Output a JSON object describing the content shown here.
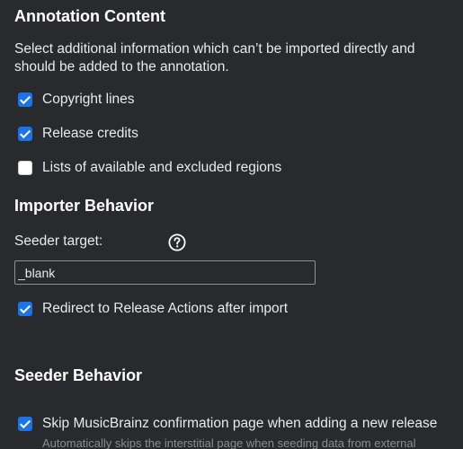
{
  "annotation": {
    "title": "Annotation Content",
    "description": "Select additional information which can’t be imported directly and should be added to the annotation.",
    "options": [
      {
        "label": "Copyright lines",
        "checked": true
      },
      {
        "label": "Release credits",
        "checked": true
      },
      {
        "label": "Lists of available and excluded regions",
        "checked": false
      }
    ]
  },
  "importer": {
    "title": "Importer Behavior",
    "seeder_target_label": "Seeder target:",
    "seeder_target_value": "_blank",
    "help_icon": "question-circle-icon",
    "redirect_label": "Redirect to Release Actions after import",
    "redirect_checked": true
  },
  "seeder": {
    "title": "Seeder Behavior",
    "skip_label": "Skip MusicBrainz confirmation page when adding a new release",
    "skip_checked": true,
    "skip_description": "Automatically skips the interstitial page when seeding data from external"
  },
  "colors": {
    "background": "#292a2d",
    "text": "#e8eaed",
    "checkbox_accent": "#1a73e8"
  }
}
